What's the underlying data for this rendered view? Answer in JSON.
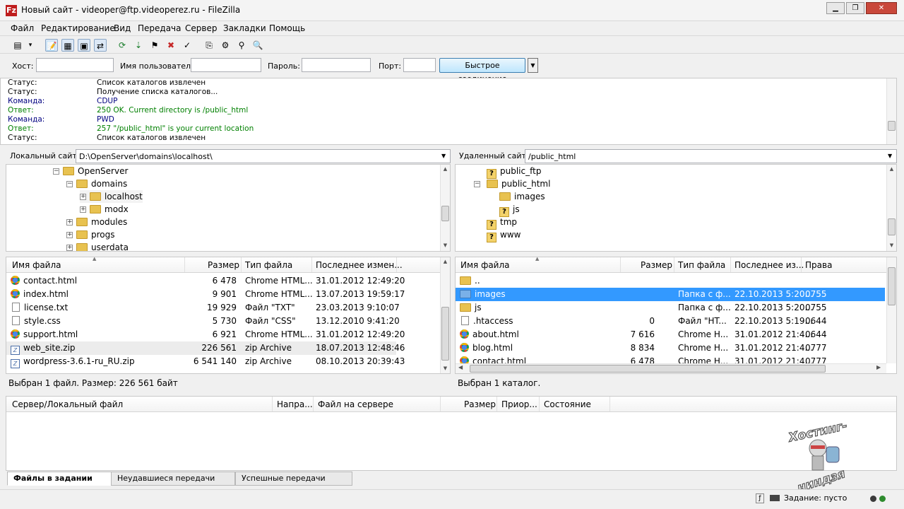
{
  "window": {
    "title": "Новый сайт - videoper@ftp.videoperez.ru - FileZilla",
    "app_icon": "filezilla-icon",
    "app_icon_letter": "Fz",
    "minimize_label": "▁",
    "restore_label": "❐",
    "close_label": "✕"
  },
  "menu": [
    "Файл",
    "Редактирование",
    "Вид",
    "Передача",
    "Сервер",
    "Закладки",
    "Помощь"
  ],
  "toolbar": {
    "icons": [
      "site-manager-icon",
      "dropdown-icon",
      "toggle-log-icon",
      "toggle-local-tree-icon",
      "toggle-remote-tree-icon",
      "toggle-queue-icon",
      "refresh-icon",
      "process-queue-icon",
      "cancel-icon",
      "disconnect-icon",
      "reconnect-icon",
      "directory-compare-icon",
      "filter-icon",
      "sync-browse-icon",
      "search-icon"
    ],
    "glyphs": [
      "▤",
      "▾",
      "📝",
      "▦",
      "▣",
      "⇄",
      "⟳",
      "⇣",
      "⚑",
      "✖",
      "✓",
      "⎘",
      "⚙",
      "⚲",
      "🔍"
    ]
  },
  "quickconnect": {
    "host_label": "Хост:",
    "user_label": "Имя пользователя",
    "pass_label": "Пароль:",
    "port_label": "Порт:",
    "host_value": "",
    "user_value": "",
    "pass_value": "",
    "port_value": "",
    "button_label": "Быстрое соединение",
    "dropdown_glyph": "▼"
  },
  "log": [
    {
      "key": "Статус:",
      "msg": "Список каталогов извлечен",
      "color": "#000000"
    },
    {
      "key": "Статус:",
      "msg": "Получение списка каталогов...",
      "color": "#000000"
    },
    {
      "key": "Команда:",
      "msg": "CDUP",
      "color": "#000080"
    },
    {
      "key": "Ответ:",
      "msg": "250 OK. Current directory is /public_html",
      "color": "#008000"
    },
    {
      "key": "Команда:",
      "msg": "PWD",
      "color": "#000080"
    },
    {
      "key": "Ответ:",
      "msg": "257 \"/public_html\" is your current location",
      "color": "#008000"
    },
    {
      "key": "Статус:",
      "msg": "Список каталогов извлечен",
      "color": "#000000"
    }
  ],
  "local": {
    "site_label": "Локальный сайт:",
    "path": "D:\\OpenServer\\domains\\localhost\\",
    "tree": [
      {
        "name": "OpenServer",
        "expander": "−"
      },
      {
        "name": "domains",
        "expander": "−"
      },
      {
        "name": "localhost",
        "expander": "+"
      },
      {
        "name": "modx",
        "expander": "+"
      },
      {
        "name": "modules",
        "expander": "+"
      },
      {
        "name": "progs",
        "expander": "+"
      },
      {
        "name": "userdata",
        "expander": "+"
      }
    ],
    "columns": [
      "Имя файла",
      "Размер",
      "Тип файла",
      "Последнее измен..."
    ],
    "files": [
      {
        "name": "contact.html",
        "size": "6 478",
        "type": "Chrome HTML...",
        "modified": "31.01.2012 12:49:20",
        "icon": "chrome-icon"
      },
      {
        "name": "index.html",
        "size": "9 901",
        "type": "Chrome HTML...",
        "modified": "13.07.2013 19:59:17",
        "icon": "chrome-icon"
      },
      {
        "name": "license.txt",
        "size": "19 929",
        "type": "Файл \"TXT\"",
        "modified": "23.03.2013 9:10:07",
        "icon": "text-file-icon"
      },
      {
        "name": "style.css",
        "size": "5 730",
        "type": "Файл \"CSS\"",
        "modified": "13.12.2010 9:41:20",
        "icon": "text-file-icon"
      },
      {
        "name": "support.html",
        "size": "6 921",
        "type": "Chrome HTML...",
        "modified": "31.01.2012 12:49:20",
        "icon": "chrome-icon"
      },
      {
        "name": "web_site.zip",
        "size": "226 561",
        "type": "zip Archive",
        "modified": "18.07.2013 12:48:46",
        "icon": "zip-icon"
      },
      {
        "name": "wordpress-3.6.1-ru_RU.zip",
        "size": "6 541 140",
        "type": "zip Archive",
        "modified": "08.10.2013 20:39:43",
        "icon": "zip-icon"
      }
    ],
    "status": "Выбран 1 файл. Размер: 226 561 байт"
  },
  "remote": {
    "site_label": "Удаленный сайт:",
    "path": "/public_html",
    "tree": [
      {
        "name": "public_ftp",
        "icon": "question-icon"
      },
      {
        "name": "public_html",
        "icon": "folder-icon",
        "expander": "−"
      },
      {
        "name": "images",
        "icon": "folder-icon"
      },
      {
        "name": "js",
        "icon": "question-icon"
      },
      {
        "name": "tmp",
        "icon": "question-icon"
      },
      {
        "name": "www",
        "icon": "question-icon"
      }
    ],
    "columns": [
      "Имя файла",
      "Размер",
      "Тип файла",
      "Последнее из...",
      "Права"
    ],
    "files": [
      {
        "name": "..",
        "size": "",
        "type": "",
        "modified": "",
        "perms": "",
        "icon": "folder-icon"
      },
      {
        "name": "images",
        "size": "",
        "type": "Папка с ф...",
        "modified": "22.10.2013 5:20...",
        "perms": "0755",
        "icon": "folder-icon"
      },
      {
        "name": "js",
        "size": "",
        "type": "Папка с ф...",
        "modified": "22.10.2013 5:20...",
        "perms": "0755",
        "icon": "folder-icon"
      },
      {
        "name": ".htaccess",
        "size": "0",
        "type": "Файл \"HT...",
        "modified": "22.10.2013 5:19...",
        "perms": "0644",
        "icon": "text-file-icon"
      },
      {
        "name": "about.html",
        "size": "7 616",
        "type": "Chrome H...",
        "modified": "31.01.2012 21:4...",
        "perms": "0644",
        "icon": "chrome-icon"
      },
      {
        "name": "blog.html",
        "size": "8 834",
        "type": "Chrome H...",
        "modified": "31.01.2012 21:4...",
        "perms": "0777",
        "icon": "chrome-icon"
      },
      {
        "name": "contact.html",
        "size": "6 478",
        "type": "Chrome H...",
        "modified": "31.01.2012 21:4...",
        "perms": "0777",
        "icon": "chrome-icon"
      }
    ],
    "status": "Выбран 1 каталог."
  },
  "queue": {
    "columns": [
      "Сервер/Локальный файл",
      "Напра...",
      "Файл на сервере",
      "Размер",
      "Приор...",
      "Состояние"
    ]
  },
  "tabs": [
    "Файлы в задании",
    "Неудавшиеся передачи",
    "Успешные передачи"
  ],
  "statusbar": {
    "queue_text": "Задание: пусто",
    "indicator_colors": [
      "#3a3a3a",
      "#2e8b2e"
    ]
  },
  "watermark": {
    "text_top": "Хостинг-",
    "text_bottom": "ниндзя"
  }
}
